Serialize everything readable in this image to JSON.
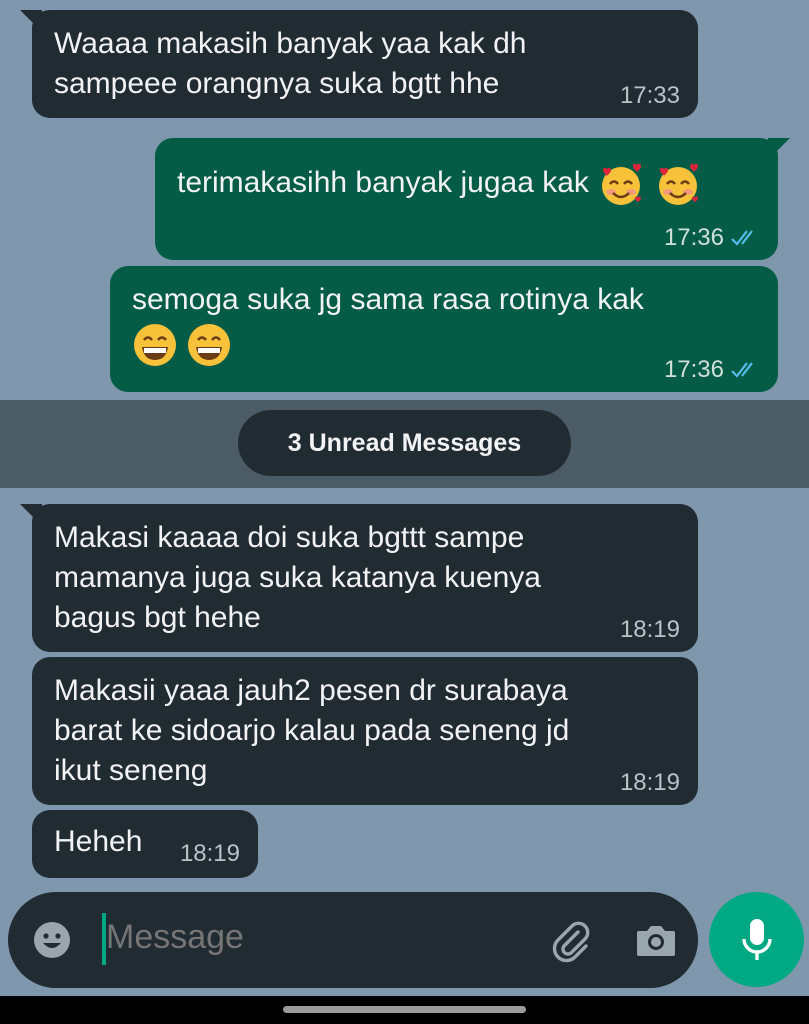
{
  "messages": [
    {
      "lines": [
        "Waaaa makasih banyak yaa kak dh",
        "sampeee orangnya suka bgtt hhe"
      ],
      "time": "17:33"
    },
    {
      "lines": [
        "terimakasihh banyak jugaa kak"
      ],
      "emojis": [
        "smiling-face-with-hearts",
        "smiling-face-with-hearts"
      ],
      "time": "17:36",
      "read": true
    },
    {
      "lines": [
        "semoga suka jg sama rasa rotinya kak"
      ],
      "emojis": [
        "grinning-face",
        "grinning-face"
      ],
      "time": "17:36",
      "read": true
    },
    {
      "lines": [
        "Makasi kaaaa doi suka bgttt sampe",
        "mamanya juga suka katanya kuenya",
        "bagus bgt hehe"
      ],
      "time": "18:19"
    },
    {
      "lines": [
        "Makasii yaaa jauh2 pesen dr surabaya",
        "barat ke sidoarjo kalau pada seneng jd",
        "ikut seneng"
      ],
      "time": "18:19"
    },
    {
      "lines": [
        "Heheh"
      ],
      "time": "18:19"
    }
  ],
  "unread_label": "3 Unread Messages",
  "composer": {
    "placeholder": "Message"
  },
  "icons": {
    "emoji": "smiley-icon",
    "attach": "paperclip-icon",
    "camera": "camera-icon",
    "mic": "microphone-icon"
  },
  "colors": {
    "incoming": "#212b32",
    "outgoing": "#055c46",
    "accent": "#00a884",
    "ticks": "#53bdeb"
  }
}
